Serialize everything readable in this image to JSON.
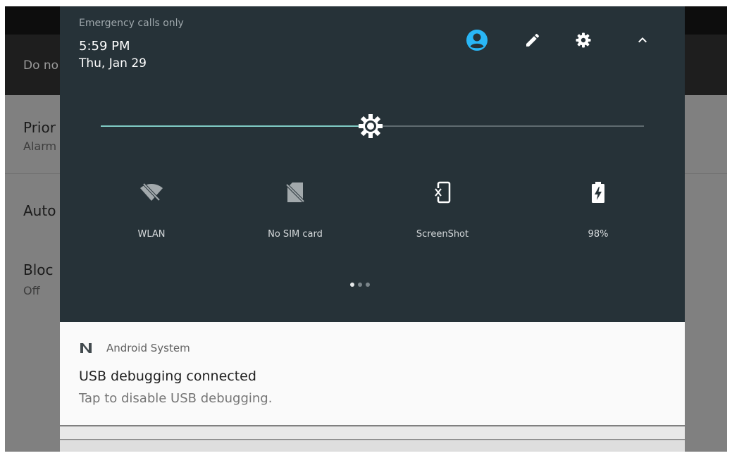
{
  "background": {
    "toolbar_title": "Do no",
    "rows": [
      {
        "title": "Prior",
        "subtitle": "Alarm"
      },
      {
        "title": "Auto",
        "subtitle": ""
      },
      {
        "title": "Bloc",
        "subtitle": "Off"
      }
    ]
  },
  "header": {
    "carrier_text": "Emergency calls only",
    "time": "5:59 PM",
    "date": "Thu, Jan 29",
    "buttons": {
      "user": "user-account-icon",
      "edit": "edit-pencil-icon",
      "settings": "gear-icon",
      "collapse": "chevron-up-icon"
    }
  },
  "brightness": {
    "level": 0.497,
    "icon": "brightness-icon"
  },
  "tiles": [
    {
      "label": "WLAN",
      "icon": "wifi-off-icon"
    },
    {
      "label": "No SIM card",
      "icon": "no-sim-icon"
    },
    {
      "label": "ScreenShot",
      "icon": "screenshot-icon"
    },
    {
      "label": "98%",
      "icon": "battery-charging-icon"
    }
  ],
  "pager": {
    "pages": 3,
    "active": 0
  },
  "notification": {
    "app_name": "Android System",
    "title": "USB debugging connected",
    "text": "Tap to disable USB debugging."
  },
  "colors": {
    "panel": "#263238",
    "accent": "#80cbc4",
    "user_icon": "#29b6f6",
    "notification_bg": "#fafafa"
  }
}
